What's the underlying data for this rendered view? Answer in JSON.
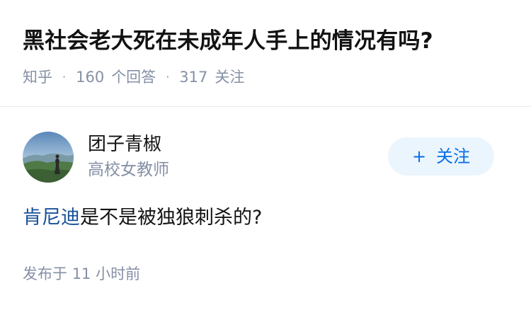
{
  "question": {
    "title": "黑社会老大死在未成年人手上的情况有吗?",
    "meta": {
      "source": "知乎",
      "separator": "·",
      "answer_count": "160",
      "answer_label": "个回答",
      "follower_count": "317",
      "follower_label": "关注"
    }
  },
  "author": {
    "avatar_icon": "landscape-avatar",
    "name": "团子青椒",
    "headline": "高校女教师",
    "follow_button": {
      "icon": "plus-icon",
      "icon_glyph": "+",
      "label": "关注"
    }
  },
  "answer": {
    "topic_link": "肯尼迪",
    "text": "是不是被独狼刺杀的?"
  },
  "footer": {
    "publish_label": "发布于",
    "publish_time": "11 小时前"
  },
  "colors": {
    "link": "#175199",
    "follow_bg": "#ebf5fd",
    "follow_text": "#056de8",
    "meta_gray": "#8590a6",
    "divider": "#ebebeb"
  }
}
